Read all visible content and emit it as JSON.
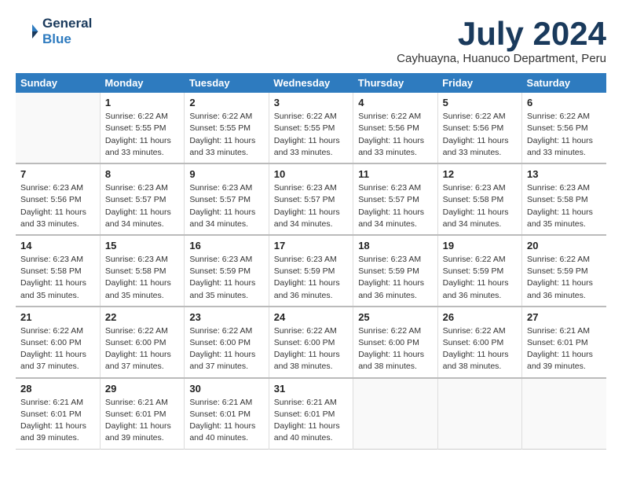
{
  "header": {
    "logo_line1": "General",
    "logo_line2": "Blue",
    "title": "July 2024",
    "subtitle": "Cayhuayna, Huanuco Department, Peru"
  },
  "weekdays": [
    "Sunday",
    "Monday",
    "Tuesday",
    "Wednesday",
    "Thursday",
    "Friday",
    "Saturday"
  ],
  "weeks": [
    [
      {
        "day": "",
        "info": ""
      },
      {
        "day": "1",
        "info": "Sunrise: 6:22 AM\nSunset: 5:55 PM\nDaylight: 11 hours\nand 33 minutes."
      },
      {
        "day": "2",
        "info": "Sunrise: 6:22 AM\nSunset: 5:55 PM\nDaylight: 11 hours\nand 33 minutes."
      },
      {
        "day": "3",
        "info": "Sunrise: 6:22 AM\nSunset: 5:55 PM\nDaylight: 11 hours\nand 33 minutes."
      },
      {
        "day": "4",
        "info": "Sunrise: 6:22 AM\nSunset: 5:56 PM\nDaylight: 11 hours\nand 33 minutes."
      },
      {
        "day": "5",
        "info": "Sunrise: 6:22 AM\nSunset: 5:56 PM\nDaylight: 11 hours\nand 33 minutes."
      },
      {
        "day": "6",
        "info": "Sunrise: 6:22 AM\nSunset: 5:56 PM\nDaylight: 11 hours\nand 33 minutes."
      }
    ],
    [
      {
        "day": "7",
        "info": "Sunrise: 6:23 AM\nSunset: 5:56 PM\nDaylight: 11 hours\nand 33 minutes."
      },
      {
        "day": "8",
        "info": "Sunrise: 6:23 AM\nSunset: 5:57 PM\nDaylight: 11 hours\nand 34 minutes."
      },
      {
        "day": "9",
        "info": "Sunrise: 6:23 AM\nSunset: 5:57 PM\nDaylight: 11 hours\nand 34 minutes."
      },
      {
        "day": "10",
        "info": "Sunrise: 6:23 AM\nSunset: 5:57 PM\nDaylight: 11 hours\nand 34 minutes."
      },
      {
        "day": "11",
        "info": "Sunrise: 6:23 AM\nSunset: 5:57 PM\nDaylight: 11 hours\nand 34 minutes."
      },
      {
        "day": "12",
        "info": "Sunrise: 6:23 AM\nSunset: 5:58 PM\nDaylight: 11 hours\nand 34 minutes."
      },
      {
        "day": "13",
        "info": "Sunrise: 6:23 AM\nSunset: 5:58 PM\nDaylight: 11 hours\nand 35 minutes."
      }
    ],
    [
      {
        "day": "14",
        "info": "Sunrise: 6:23 AM\nSunset: 5:58 PM\nDaylight: 11 hours\nand 35 minutes."
      },
      {
        "day": "15",
        "info": "Sunrise: 6:23 AM\nSunset: 5:58 PM\nDaylight: 11 hours\nand 35 minutes."
      },
      {
        "day": "16",
        "info": "Sunrise: 6:23 AM\nSunset: 5:59 PM\nDaylight: 11 hours\nand 35 minutes."
      },
      {
        "day": "17",
        "info": "Sunrise: 6:23 AM\nSunset: 5:59 PM\nDaylight: 11 hours\nand 36 minutes."
      },
      {
        "day": "18",
        "info": "Sunrise: 6:23 AM\nSunset: 5:59 PM\nDaylight: 11 hours\nand 36 minutes."
      },
      {
        "day": "19",
        "info": "Sunrise: 6:22 AM\nSunset: 5:59 PM\nDaylight: 11 hours\nand 36 minutes."
      },
      {
        "day": "20",
        "info": "Sunrise: 6:22 AM\nSunset: 5:59 PM\nDaylight: 11 hours\nand 36 minutes."
      }
    ],
    [
      {
        "day": "21",
        "info": "Sunrise: 6:22 AM\nSunset: 6:00 PM\nDaylight: 11 hours\nand 37 minutes."
      },
      {
        "day": "22",
        "info": "Sunrise: 6:22 AM\nSunset: 6:00 PM\nDaylight: 11 hours\nand 37 minutes."
      },
      {
        "day": "23",
        "info": "Sunrise: 6:22 AM\nSunset: 6:00 PM\nDaylight: 11 hours\nand 37 minutes."
      },
      {
        "day": "24",
        "info": "Sunrise: 6:22 AM\nSunset: 6:00 PM\nDaylight: 11 hours\nand 38 minutes."
      },
      {
        "day": "25",
        "info": "Sunrise: 6:22 AM\nSunset: 6:00 PM\nDaylight: 11 hours\nand 38 minutes."
      },
      {
        "day": "26",
        "info": "Sunrise: 6:22 AM\nSunset: 6:00 PM\nDaylight: 11 hours\nand 38 minutes."
      },
      {
        "day": "27",
        "info": "Sunrise: 6:21 AM\nSunset: 6:01 PM\nDaylight: 11 hours\nand 39 minutes."
      }
    ],
    [
      {
        "day": "28",
        "info": "Sunrise: 6:21 AM\nSunset: 6:01 PM\nDaylight: 11 hours\nand 39 minutes."
      },
      {
        "day": "29",
        "info": "Sunrise: 6:21 AM\nSunset: 6:01 PM\nDaylight: 11 hours\nand 39 minutes."
      },
      {
        "day": "30",
        "info": "Sunrise: 6:21 AM\nSunset: 6:01 PM\nDaylight: 11 hours\nand 40 minutes."
      },
      {
        "day": "31",
        "info": "Sunrise: 6:21 AM\nSunset: 6:01 PM\nDaylight: 11 hours\nand 40 minutes."
      },
      {
        "day": "",
        "info": ""
      },
      {
        "day": "",
        "info": ""
      },
      {
        "day": "",
        "info": ""
      }
    ]
  ]
}
